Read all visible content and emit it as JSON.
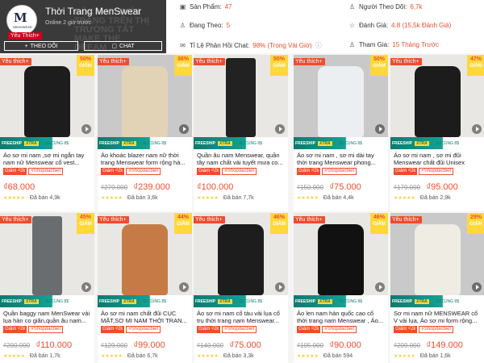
{
  "shop": {
    "name": "Thời Trang MenSwear",
    "online": "Online 2 giờ trước",
    "favorite_tag": "Yêu Thích+",
    "avatar_text": "MENSWEAR",
    "banner_text": "ĐỘC MAY THỜI TRANG TRÊN THỊ TRƯỜNG TẤT MAKE THE DREAM",
    "follow_label": "THEO DÕI",
    "chat_label": "CHAT"
  },
  "stats": {
    "products_label": "Sản Phẩm:",
    "products_value": "47",
    "following_label": "Đang Theo:",
    "following_value": "5",
    "response_label": "Tỉ Lệ Phản Hồi Chat:",
    "response_value": "98% (Trong Vài Giờ)",
    "followers_label": "Người Theo Dõi:",
    "followers_value": "6,7k",
    "rating_label": "Đánh Giá:",
    "rating_value": "4.8 (15,5k Đánh Giá)",
    "joined_label": "Tham Gia:",
    "joined_value": "15 Tháng Trước"
  },
  "labels": {
    "favorite": "Yêu thích+",
    "giam": "GIẢM",
    "freeship": "FREESHIP",
    "xtra": "XTRA",
    "gift": "GI CÙNG 8$",
    "discount_tag": "Giảm ₫2k",
    "shop_tag": "#Shopdacbiet",
    "stars": "★★★★★"
  },
  "products": [
    {
      "title": "Áo sơ mi nam ,sơ mi ngắn tay nam nữ Menswear cổ vest...",
      "discount": "50%",
      "old_price": "",
      "price": "₫68.000",
      "sold": "Đã bán 4,9k",
      "color": "#1d1d1d"
    },
    {
      "title": "Áo khoác blazer nam nữ thời trang Menswear form rộng hà...",
      "discount": "36%",
      "old_price": "₫279.000",
      "price": "₫239.000",
      "sold": "Đã bán 3,6k",
      "color": "#e3d3b6"
    },
    {
      "title": "Quần âu nam Menswear, quần tây nam chất vải tuyết mưa co...",
      "discount": "50%",
      "old_price": "",
      "price": "₫100.000",
      "sold": "Đã bán 7,7k",
      "color": "#222222"
    },
    {
      "title": "Áo sơ mi nam , sơ mi dài tay thời trang Menswear phong...",
      "discount": "50%",
      "old_price": "₫150.000",
      "price": "₫75.000",
      "sold": "Đã bán 4,4k",
      "color": "#eceff2"
    },
    {
      "title": "Áo sơ mi nam , sơ mi đũi Menswear chất đũi Unisex nam...",
      "discount": "47%",
      "old_price": "₫179.000",
      "price": "₫95.000",
      "sold": "Đã bán 2,9k",
      "color": "#1c1c1c"
    },
    {
      "title": "Quần baggy nam MenSwear vải lụa hàn co giãn,quần âu nam...",
      "discount": "45%",
      "old_price": "₫200.000",
      "price": "₫110.000",
      "sold": "Đã bán 1,7k",
      "color": "#6a6d70"
    },
    {
      "title": "Áo sơ mi nam chất đũi CỤC MẶT,SƠ MI NAM THỜI TRAN...",
      "discount": "44%",
      "old_price": "₫129.000",
      "price": "₫99.000",
      "sold": "Đã bán 6,7k",
      "color": "#c67b47"
    },
    {
      "title": "Áo sơ mi nam cổ tàu vải lụa cổ trụ thời trang nam Menswear...",
      "discount": "46%",
      "old_price": "₫140.000",
      "price": "₫75.000",
      "sold": "Đã bán 3,3k",
      "color": "#1d1d1d"
    },
    {
      "title": "Áo len nam hàn quốc cao cổ thời trang nam Menswear , Áo...",
      "discount": "46%",
      "old_price": "₫105.000",
      "price": "₫90.000",
      "sold": "Đã bán 594",
      "color": "#111111"
    },
    {
      "title": "Sơ mi nam nữ MENSWEAR cổ V vải lụa, Áo sơ mi form rộng...",
      "discount": "29%",
      "old_price": "₫209.000",
      "price": "₫149.000",
      "sold": "Đã bán 1,6k",
      "color": "#efece4"
    }
  ]
}
